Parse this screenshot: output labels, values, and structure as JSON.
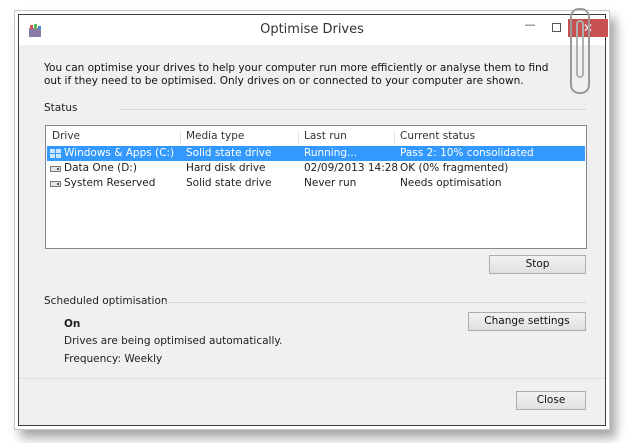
{
  "window": {
    "title": "Optimise Drives",
    "minimize_glyph": "—",
    "close_glyph": "✕"
  },
  "intro": "You can optimise your drives to help your computer run more efficiently or analyse them to find out if they need to be optimised. Only drives on or connected to your computer are shown.",
  "status": {
    "label": "Status",
    "columns": [
      "Drive",
      "Media type",
      "Last run",
      "Current status"
    ],
    "rows": [
      {
        "drive": "Windows & Apps (C:)",
        "media": "Solid state drive",
        "last_run": "Running...",
        "status": "Pass 2: 10% consolidated",
        "icon": "windows-drive-icon",
        "selected": true
      },
      {
        "drive": "Data One (D:)",
        "media": "Hard disk drive",
        "last_run": "02/09/2013 14:28",
        "status": "OK (0% fragmented)",
        "icon": "hard-drive-icon",
        "selected": false
      },
      {
        "drive": "System Reserved",
        "media": "Solid state drive",
        "last_run": "Never run",
        "status": "Needs optimisation",
        "icon": "hard-drive-icon",
        "selected": false
      }
    ],
    "stop_button": "Stop"
  },
  "scheduled": {
    "label": "Scheduled optimisation",
    "state": "On",
    "description": "Drives are being optimised automatically.",
    "frequency": "Frequency: Weekly",
    "change_button": "Change settings"
  },
  "footer": {
    "close_button": "Close"
  },
  "colors": {
    "selection": "#3399ff",
    "close_button": "#c75050",
    "window_bg": "#f0f0f0"
  }
}
